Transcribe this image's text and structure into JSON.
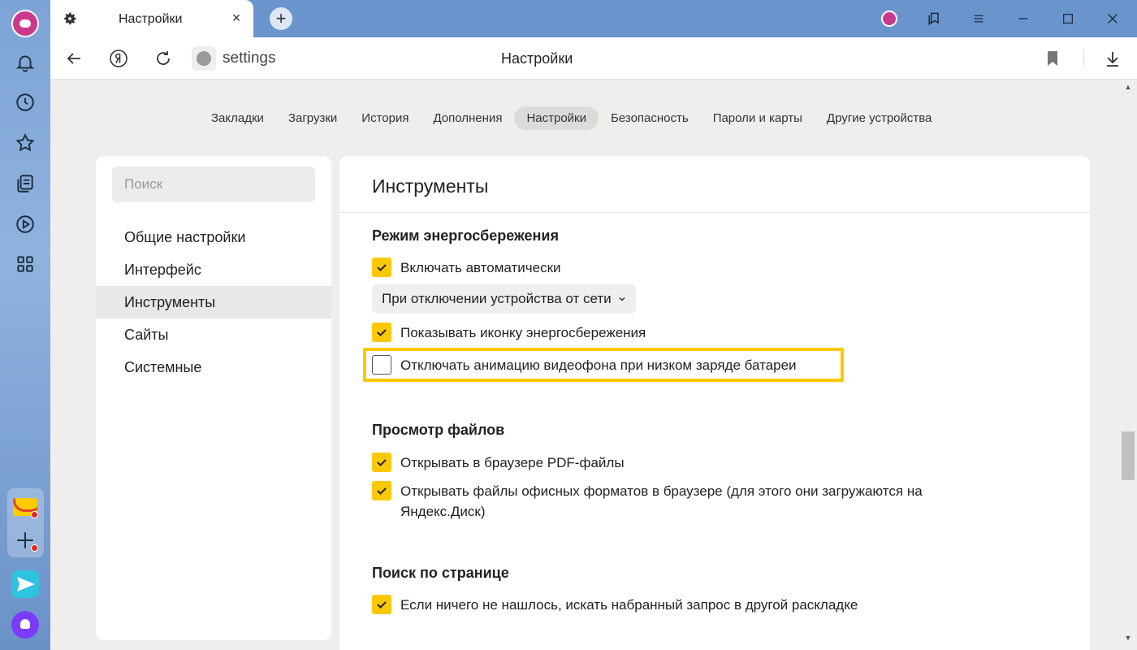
{
  "browser": {
    "tab_title": "Настройки",
    "tab_close": "×",
    "new_tab": "+",
    "address": "settings",
    "page_heading": "Настройки"
  },
  "side_panel": {
    "icons": [
      "bell-icon",
      "history-icon",
      "star-icon",
      "collections-icon",
      "play-icon",
      "apps-grid-icon"
    ],
    "apps": [
      "mail-icon",
      "add-app-icon",
      "messenger-icon",
      "alice-icon"
    ]
  },
  "settings_tabs": [
    "Закладки",
    "Загрузки",
    "История",
    "Дополнения",
    "Настройки",
    "Безопасность",
    "Пароли и карты",
    "Другие устройства"
  ],
  "settings_tab_active": "Настройки",
  "menu": {
    "search_placeholder": "Поиск",
    "items": [
      "Общие настройки",
      "Интерфейс",
      "Инструменты",
      "Сайты",
      "Системные"
    ],
    "active": "Инструменты"
  },
  "content": {
    "title": "Инструменты",
    "energy": {
      "title": "Режим энергосбережения",
      "auto_label": "Включать автоматически",
      "auto_checked": true,
      "mode_dropdown": "При отключении устройства от сети",
      "show_icon_label": "Показывать иконку энергосбережения",
      "show_icon_checked": true,
      "disable_anim_label": "Отключать анимацию видеофона при низком заряде батареи",
      "disable_anim_checked": false
    },
    "files": {
      "title": "Просмотр файлов",
      "pdf_label": "Открывать в браузере PDF-файлы",
      "pdf_checked": true,
      "office_label": "Открывать файлы офисных форматов в браузере (для этого они загружаются на Яндекс.Диск)",
      "office_checked": true
    },
    "find": {
      "title": "Поиск по странице",
      "layout_label": "Если ничего не нашлось, искать набранный запрос в другой раскладке",
      "layout_checked": true
    }
  },
  "colors": {
    "accent": "#fcc800",
    "side_panel": "#7da4d6"
  }
}
